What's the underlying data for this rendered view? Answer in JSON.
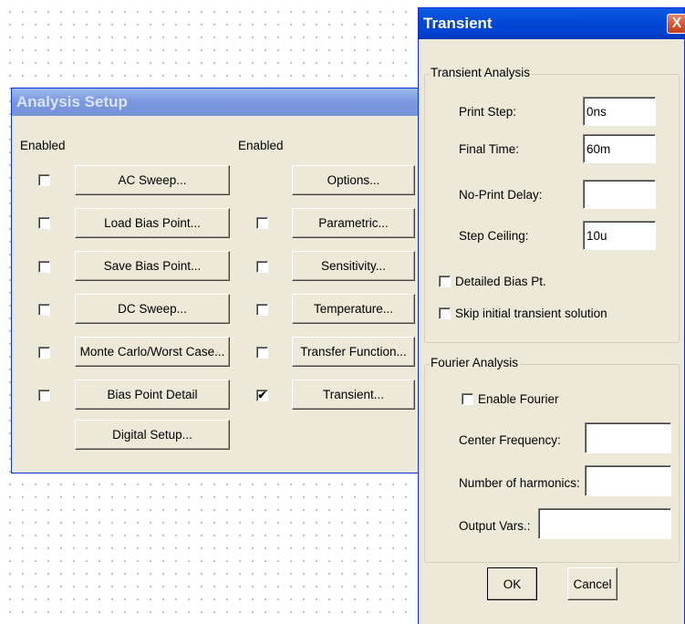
{
  "analysis_setup": {
    "title": "Analysis Setup",
    "enabled_header_left": "Enabled",
    "enabled_header_right": "Enabled",
    "left_buttons": [
      {
        "label": "AC Sweep...",
        "checked": false
      },
      {
        "label": "Load Bias Point...",
        "checked": false
      },
      {
        "label": "Save Bias Point...",
        "checked": false
      },
      {
        "label": "DC Sweep...",
        "checked": false
      },
      {
        "label": "Monte Carlo/Worst Case...",
        "checked": false
      },
      {
        "label": "Bias Point Detail",
        "checked": false
      },
      {
        "label": "Digital Setup..."
      }
    ],
    "right_buttons": [
      {
        "label": "Options..."
      },
      {
        "label": "Parametric...",
        "checked": false
      },
      {
        "label": "Sensitivity...",
        "checked": false
      },
      {
        "label": "Temperature...",
        "checked": false
      },
      {
        "label": "Transfer Function...",
        "checked": false
      },
      {
        "label": "Transient...",
        "checked": true,
        "check_mark": "✔"
      }
    ]
  },
  "transient": {
    "title": "Transient",
    "close_icon": "X",
    "transient_group": {
      "title": "Transient Analysis",
      "print_step_label": "Print Step:",
      "print_step_value": "0ns",
      "final_time_label": "Final Time:",
      "final_time_value": "60m",
      "no_print_delay_label": "No-Print Delay:",
      "no_print_delay_value": "",
      "step_ceiling_label": "Step Ceiling:",
      "step_ceiling_value": "10u",
      "detailed_bias_label": "Detailed Bias Pt.",
      "skip_initial_label": "Skip initial transient solution"
    },
    "fourier_group": {
      "title": "Fourier Analysis",
      "enable_fourier_label": "Enable Fourier",
      "center_freq_label": "Center Frequency:",
      "center_freq_value": "",
      "harmonics_label": "Number of harmonics:",
      "harmonics_value": "",
      "output_vars_label": "Output Vars.:",
      "output_vars_value": ""
    },
    "ok_label": "OK",
    "cancel_label": "Cancel"
  }
}
